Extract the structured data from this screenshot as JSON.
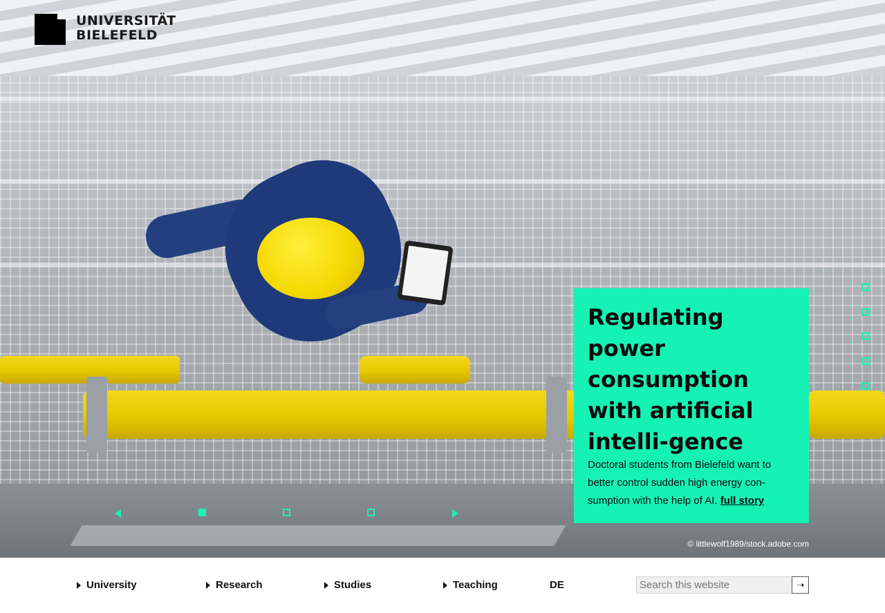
{
  "brand": {
    "line1": "UNIVERSITÄT",
    "line2": "BIELEFELD"
  },
  "hero": {
    "image_alt": "Worker in yellow helmet with tablet above yellow gas pipes",
    "credit": "© littlewolf1989/stock.adobe.com"
  },
  "story": {
    "title": "Regulating power consumption with artificial intelli-gence",
    "text": "Doctoral students from Bielefeld want to better control sudden high energy con-sumption with the help of AI.",
    "link_label": "full story"
  },
  "carousel": {
    "slides": 3,
    "active": 1
  },
  "side_pager": {
    "count": 5
  },
  "nav": {
    "items": [
      {
        "label": "University"
      },
      {
        "label": "Research"
      },
      {
        "label": "Studies"
      },
      {
        "label": "Teaching"
      }
    ],
    "lang": "DE"
  },
  "search": {
    "placeholder": "Search this website",
    "value": "",
    "button_icon": "arrow-right-icon"
  },
  "colors": {
    "accent": "#16f2b4",
    "text": "#111111"
  }
}
